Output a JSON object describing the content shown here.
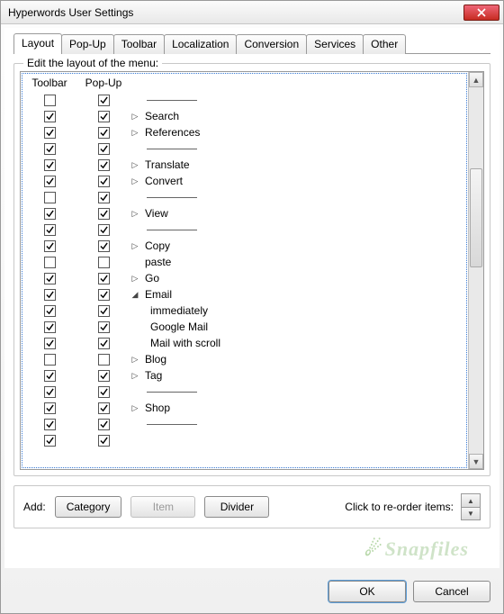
{
  "window": {
    "title": "Hyperwords User Settings"
  },
  "tabs": [
    "Layout",
    "Pop-Up",
    "Toolbar",
    "Localization",
    "Conversion",
    "Services",
    "Other"
  ],
  "active_tab": 0,
  "group": {
    "label": "Edit the layout of the menu:"
  },
  "columns": {
    "toolbar": "Toolbar",
    "popup": "Pop-Up"
  },
  "rows": [
    {
      "tb": false,
      "pu": true,
      "kind": "sep"
    },
    {
      "tb": true,
      "pu": true,
      "kind": "item",
      "disc": "right",
      "label": "Search"
    },
    {
      "tb": true,
      "pu": true,
      "kind": "item",
      "disc": "right",
      "label": "References"
    },
    {
      "tb": true,
      "pu": true,
      "kind": "sep"
    },
    {
      "tb": true,
      "pu": true,
      "kind": "item",
      "disc": "right",
      "label": "Translate"
    },
    {
      "tb": true,
      "pu": true,
      "kind": "item",
      "disc": "right",
      "label": "Convert"
    },
    {
      "tb": false,
      "pu": true,
      "kind": "sep"
    },
    {
      "tb": true,
      "pu": true,
      "kind": "item",
      "disc": "right",
      "label": "View"
    },
    {
      "tb": true,
      "pu": true,
      "kind": "sep"
    },
    {
      "tb": true,
      "pu": true,
      "kind": "item",
      "disc": "right",
      "label": "Copy"
    },
    {
      "tb": false,
      "pu": false,
      "kind": "item",
      "disc": "",
      "label": "paste"
    },
    {
      "tb": true,
      "pu": true,
      "kind": "item",
      "disc": "right",
      "label": "Go"
    },
    {
      "tb": true,
      "pu": true,
      "kind": "item",
      "disc": "down",
      "label": "Email"
    },
    {
      "tb": true,
      "pu": true,
      "kind": "sub",
      "label": "immediately"
    },
    {
      "tb": true,
      "pu": true,
      "kind": "sub",
      "label": "Google Mail"
    },
    {
      "tb": true,
      "pu": true,
      "kind": "sub",
      "label": "Mail with scroll"
    },
    {
      "tb": false,
      "pu": false,
      "kind": "item",
      "disc": "right",
      "label": "Blog"
    },
    {
      "tb": true,
      "pu": true,
      "kind": "item",
      "disc": "right",
      "label": "Tag"
    },
    {
      "tb": true,
      "pu": true,
      "kind": "sep"
    },
    {
      "tb": true,
      "pu": true,
      "kind": "item",
      "disc": "right",
      "label": "Shop"
    },
    {
      "tb": true,
      "pu": true,
      "kind": "sep"
    },
    {
      "tb": true,
      "pu": true,
      "kind": "blank"
    }
  ],
  "add": {
    "label": "Add:",
    "category": "Category",
    "item": "Item",
    "divider": "Divider",
    "reorder_label": "Click to re-order items:"
  },
  "watermark": "Snapfiles",
  "footer": {
    "ok": "OK",
    "cancel": "Cancel"
  }
}
